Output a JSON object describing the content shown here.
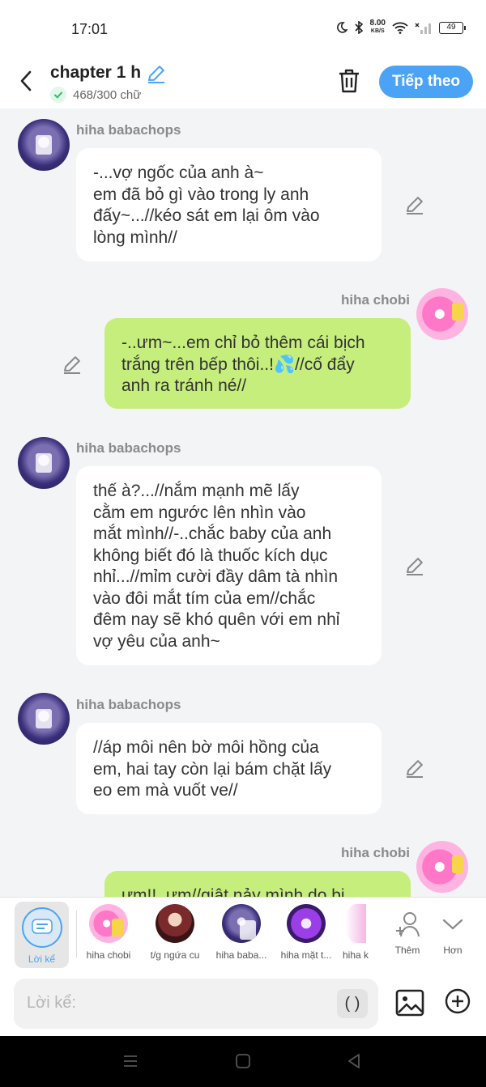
{
  "status_bar": {
    "time": "17:01",
    "net_speed_value": "8.00",
    "net_speed_unit": "KB/S",
    "battery": "49"
  },
  "header": {
    "title": "chapter 1 h",
    "word_count": "468/300 chữ",
    "next_label": "Tiếp theo",
    "accent_color": "#4ba3f5"
  },
  "messages": [
    {
      "side": "left",
      "sender": "hiha babachops",
      "lines": [
        "-...vợ ngốc của anh à~",
        "em đã bỏ gì vào trong ly anh",
        "đấy~...//kéo sát em lại ôm vào",
        "lòng mình//"
      ]
    },
    {
      "side": "right",
      "sender": "hiha chobi",
      "lines": [
        "-..ưm~...em chỉ bỏ thêm cái bịch",
        "trắng trên bếp thôi..!💦//cố đẩy",
        "anh ra tránh né//"
      ]
    },
    {
      "side": "left",
      "sender": "hiha babachops",
      "lines": [
        "thế à?...//nắm mạnh mẽ lấy",
        "cằm em ngước lên nhìn vào",
        "mắt mình//-..chắc baby của anh",
        "không biết đó là thuốc kích dục",
        "nhỉ...//mỉm cười đầy dâm tà nhìn",
        "vào đôi mắt tím của em//chắc",
        "đêm nay sẽ khó quên với em nhỉ",
        "vợ yêu của anh~"
      ]
    },
    {
      "side": "left",
      "sender": "hiha babachops",
      "lines": [
        "//áp môi nên bờ môi hồng của",
        "em, hai tay còn lại bám chặt lấy",
        "eo em mà vuốt ve//"
      ]
    },
    {
      "side": "right",
      "sender": "hiha chobi",
      "lines": [
        "ưm!!..ưm//giật nảy mình do bị"
      ]
    }
  ],
  "characters": {
    "narrator_label": "Lời kể",
    "items": [
      {
        "name": "hiha chobi"
      },
      {
        "name": "t/g ngứa cu"
      },
      {
        "name": "hiha baba..."
      },
      {
        "name": "hiha mặt t..."
      },
      {
        "name": "hiha k"
      }
    ],
    "more_label": "Thêm",
    "less_label": "Hơn"
  },
  "composer": {
    "placeholder": "Lời kể:",
    "paren_label": "( )"
  },
  "colors": {
    "left_bubble": "#ffffff",
    "right_bubble": "#c6ee7d",
    "background": "#f3f4f6"
  }
}
